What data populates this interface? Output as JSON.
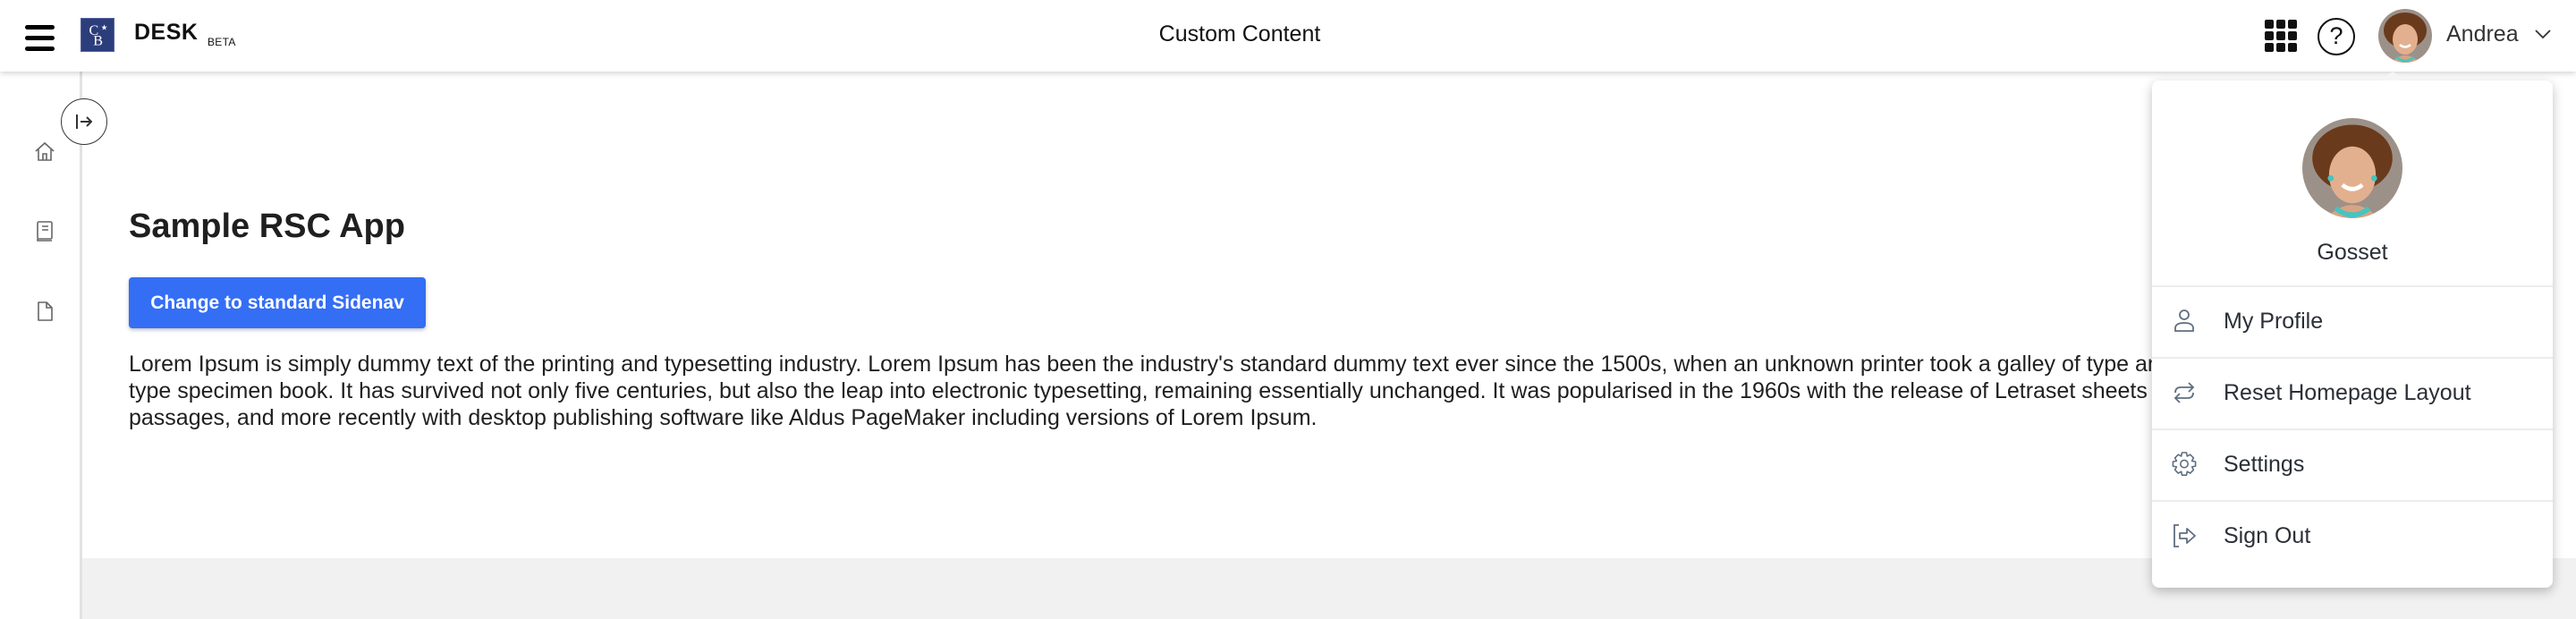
{
  "header": {
    "brand": "DESK",
    "brand_tag": "BETA",
    "title": "Custom Content",
    "user_name": "Andrea"
  },
  "sidebar": {
    "items": [
      {
        "icon": "home-icon"
      },
      {
        "icon": "book-icon"
      },
      {
        "icon": "document-icon"
      }
    ]
  },
  "main": {
    "title": "Sample RSC App",
    "button_label": "Change to standard Sidenav",
    "body_text": "Lorem Ipsum is simply dummy text of the printing and typesetting industry. Lorem Ipsum has been the industry's standard dummy text ever since the 1500s, when an unknown printer took a galley of type and scrambled it to make a type specimen book. It has survived not only five centuries, but also the leap into electronic typesetting, remaining essentially unchanged. It was popularised in the 1960s with the release of Letraset sheets containing Lorem Ipsum passages, and more recently with desktop publishing software like Aldus PageMaker including versions of Lorem Ipsum."
  },
  "profile_menu": {
    "name": "Gosset",
    "items": [
      {
        "label": "My Profile",
        "icon": "person-icon"
      },
      {
        "label": "Reset Homepage Layout",
        "icon": "refresh-arrows-icon"
      },
      {
        "label": "Settings",
        "icon": "gear-icon"
      },
      {
        "label": "Sign Out",
        "icon": "sign-out-icon"
      }
    ]
  },
  "colors": {
    "primary": "#346ef5",
    "logo": "#2c3d7c",
    "menu_icon": "#5f6f80"
  }
}
